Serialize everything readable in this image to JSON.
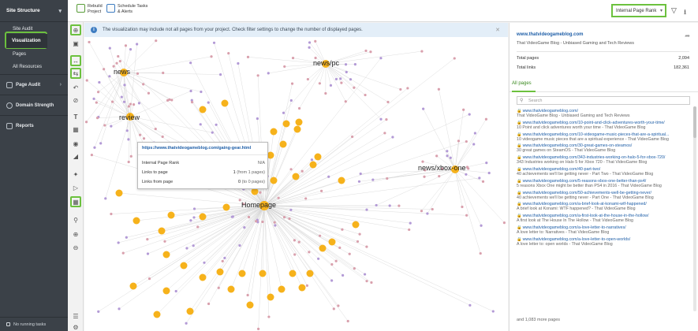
{
  "sidebar": {
    "header": "Site Structure",
    "items": [
      {
        "label": "Site Audit"
      },
      {
        "label": "Visualization"
      },
      {
        "label": "Pages"
      },
      {
        "label": "All Resources"
      }
    ],
    "sections": [
      {
        "label": "Page Audit"
      },
      {
        "label": "Domain Strength"
      },
      {
        "label": "Reports"
      }
    ],
    "footer": "No running tasks"
  },
  "toolbar": {
    "rebuild_label": "Rebuild Project",
    "rebuild_line1": "Rebuild",
    "rebuild_line2": "Project",
    "schedule_line1": "Schedule Tasks",
    "schedule_line2": "& Alerts",
    "metric_select": "Internal Page Rank"
  },
  "info": {
    "message": "The visualization may include not all pages from your project. Check filter settings to change the number of displayed pages."
  },
  "graph": {
    "labels": {
      "news": "news",
      "newspc": "news/pc",
      "review": "review",
      "xbox": "news/xbox-one",
      "home": "Homepage"
    },
    "colors": {
      "hub": "#f6b21b",
      "node_pink": "#d9a0ad",
      "node_purple": "#b39ad6",
      "edge": "#d4d4d4"
    }
  },
  "tooltip": {
    "url": "https://www.thatvideogameblog.com/gaing-gear.html",
    "rank_label": "Internal Page Rank",
    "rank_value": "N/A",
    "links_to_label": "Links to page",
    "links_to_count": "1",
    "links_to_note": "(from 1 pages)",
    "links_from_label": "Links from page",
    "links_from_count": "0",
    "links_from_note": "(to 0 pages)"
  },
  "panel": {
    "site": "www.thatvideogameblog.com",
    "description": "That VideoGame Blog - Unbiased Gaming and Tech Reviews",
    "total_pages_label": "Total pages",
    "total_pages": "2,094",
    "total_links_label": "Total links",
    "total_links": "182,361",
    "tab": "All pages",
    "search_placeholder": "Search",
    "pages": [
      {
        "url": "www.thatvideogameblog.com/",
        "title": "That VideoGame Blog - Unbiased Gaming and Tech Reviews"
      },
      {
        "url": "www.thatvideogameblog.com/10-point-and-click-adventures-worth-your-time/",
        "title": "10 Point and click adventures worth your time - That VideoGame Blog"
      },
      {
        "url": "www.thatvideogameblog.com/10-videogame-music-pieces-that-are-a-spiritual...",
        "title": "10 videogame music pieces that are a spiritual experience - That VideoGame Blog"
      },
      {
        "url": "www.thatvideogameblog.com/30-great-games-on-steamos/",
        "title": "30 great games on SteamOS - That VideoGame Blog"
      },
      {
        "url": "www.thatvideogameblog.com/343-industries-working-on-halo-5-for-xbox-720/",
        "title": "343 Industries working on Halo 5 for Xbox 720 - That VideoGame Blog"
      },
      {
        "url": "www.thatvideogameblog.com/40-part-two/",
        "title": "40 achievements we'll be getting never - Part Two - That VideoGame Blog"
      },
      {
        "url": "www.thatvideogameblog.com/5-reasons-xbox-one-better-than-ps4/",
        "title": "5 reasons Xbox One might be better than PS4 in 2016 - That VideoGame Blog"
      },
      {
        "url": "www.thatvideogameblog.com/50-achievements-well-be-getting-never/",
        "title": "40 achievements we'll be getting never - Part One - That VideoGame Blog"
      },
      {
        "url": "www.thatvideogameblog.com/a-brief-look-at-konami-wtf-happened/",
        "title": "A brief look at Konami: WTF happened? - That VideoGame Blog"
      },
      {
        "url": "www.thatvideogameblog.com/a-first-look-at-the-house-in-the-hollow/",
        "title": "A first look at The House In The Hollow - That VideoGame Blog"
      },
      {
        "url": "www.thatvideogameblog.com/a-love-letter-to-narratives/",
        "title": "A love letter to: Narratives - That VideoGame Blog"
      },
      {
        "url": "www.thatvideogameblog.com/a-love-letter-to-open-worlds/",
        "title": "A love letter to: open worlds - That VideoGame Blog"
      }
    ],
    "more": "and 1,083 more pages"
  }
}
